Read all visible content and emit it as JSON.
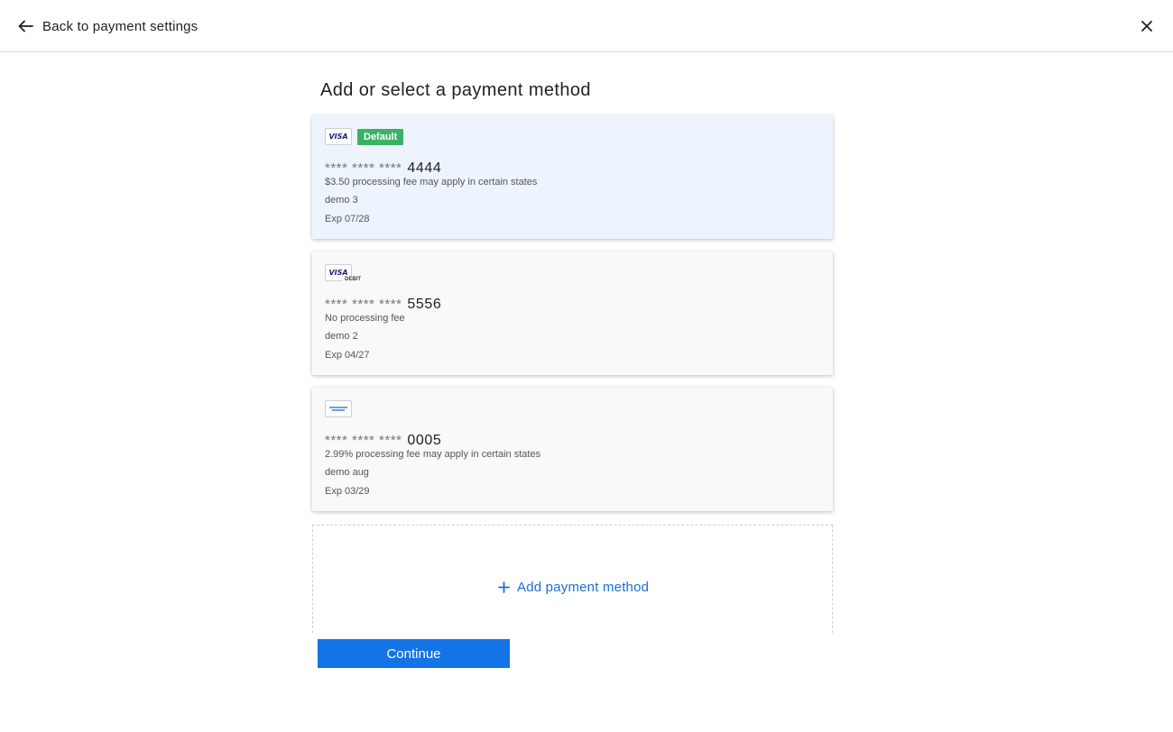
{
  "header": {
    "back_label": "Back to payment settings",
    "back_icon": "arrow-left-icon",
    "close_icon": "close-icon"
  },
  "page": {
    "title": "Add or select a payment method"
  },
  "cards": [
    {
      "brand": "VISA",
      "brand_sub": "",
      "default_badge": "Default",
      "mask": "**** **** ****",
      "last4": "4444",
      "fee": "$3.50 processing fee may apply in certain states",
      "nickname": "demo 3",
      "exp": "Exp 07/28",
      "selected": true
    },
    {
      "brand": "VISA",
      "brand_sub": "DEBIT",
      "default_badge": "",
      "mask": "**** **** ****",
      "last4": "5556",
      "fee": "No processing fee",
      "nickname": "demo 2",
      "exp": "Exp 04/27",
      "selected": false
    },
    {
      "brand": "",
      "brand_sub": "",
      "brand_icon": "amex-card-icon",
      "default_badge": "",
      "mask": "**** **** ****",
      "last4": "0005",
      "fee": "2.99% processing fee may apply in certain states",
      "nickname": "demo aug",
      "exp": "Exp 03/29",
      "selected": false
    }
  ],
  "add_method": {
    "label": "Add payment method",
    "icon": "plus-icon"
  },
  "actions": {
    "continue_label": "Continue"
  },
  "colors": {
    "accent": "#1473e6",
    "link": "#1a6fd4",
    "default_badge": "#3ab265",
    "selected_card": "#eef4fd"
  }
}
